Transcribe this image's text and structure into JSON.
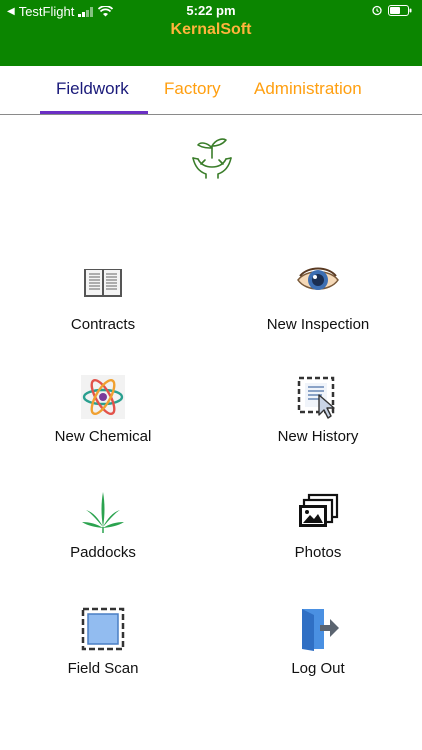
{
  "status_bar": {
    "back_app": "TestFlight",
    "time": "5:22 pm"
  },
  "header": {
    "title": "KernalSoft"
  },
  "tabs": [
    {
      "label": "Fieldwork",
      "active": true
    },
    {
      "label": "Factory",
      "active": false
    },
    {
      "label": "Administration",
      "active": false
    }
  ],
  "colors": {
    "header_bg": "#0b8500",
    "title_color": "#ffb43c",
    "tab_inactive": "#ff9f10",
    "tab_active": "#1a1a7a",
    "tab_indicator": "#6b2fc4"
  },
  "logo_icon": "plant-in-hands-icon",
  "menu": [
    {
      "label": "Contracts",
      "icon": "book-icon"
    },
    {
      "label": "New Inspection",
      "icon": "eye-icon"
    },
    {
      "label": "New Chemical",
      "icon": "atom-icon"
    },
    {
      "label": "New History",
      "icon": "document-cursor-icon"
    },
    {
      "label": "Paddocks",
      "icon": "leaf-icon"
    },
    {
      "label": "Photos",
      "icon": "photos-icon"
    },
    {
      "label": "Field Scan",
      "icon": "scan-square-icon"
    },
    {
      "label": "Log Out",
      "icon": "logout-door-icon"
    }
  ]
}
